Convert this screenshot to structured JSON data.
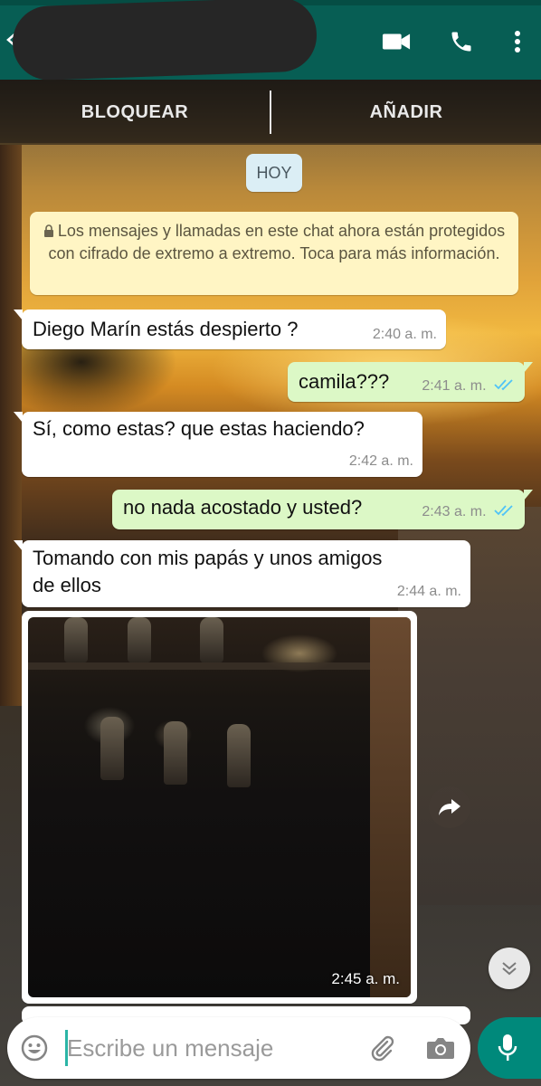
{
  "header": {
    "contact_name_redacted": true
  },
  "actions": {
    "block_label": "BLOQUEAR",
    "add_label": "AÑADIR"
  },
  "chat": {
    "date_label": "HOY",
    "encryption_notice": "Los mensajes y llamadas en este chat ahora están protegidos con cifrado de extremo a extremo. Toca para más información.",
    "messages": [
      {
        "direction": "in",
        "text": "Diego Marín estás despierto ?",
        "time": "2:40 a. m."
      },
      {
        "direction": "out",
        "text": "camila???",
        "time": "2:41 a. m.",
        "status": "read"
      },
      {
        "direction": "in",
        "text": "Sí, como estas? que estas haciendo?",
        "time": "2:42 a. m."
      },
      {
        "direction": "out",
        "text": "no nada acostado y usted?",
        "time": "2:43 a. m.",
        "status": "read"
      },
      {
        "direction": "in",
        "text_line1": "Tomando con mis papás y unos amigos",
        "text_line2": "de ellos",
        "time": "2:44 a. m."
      },
      {
        "direction": "in",
        "type": "photo",
        "time": "2:45 a. m."
      }
    ]
  },
  "composer": {
    "placeholder": "Escribe un mensaje"
  },
  "colors": {
    "header": "#075e54",
    "outgoing_bubble": "#dcf8c6",
    "incoming_bubble": "#ffffff",
    "read_ticks": "#4fc3f7",
    "mic_button": "#00897b"
  },
  "icons": [
    "back-arrow-icon",
    "video-call-icon",
    "phone-icon",
    "more-vert-icon",
    "lock-icon",
    "double-check-icon",
    "forward-icon",
    "chevrons-down-icon",
    "emoji-icon",
    "paperclip-icon",
    "camera-icon",
    "mic-icon"
  ]
}
